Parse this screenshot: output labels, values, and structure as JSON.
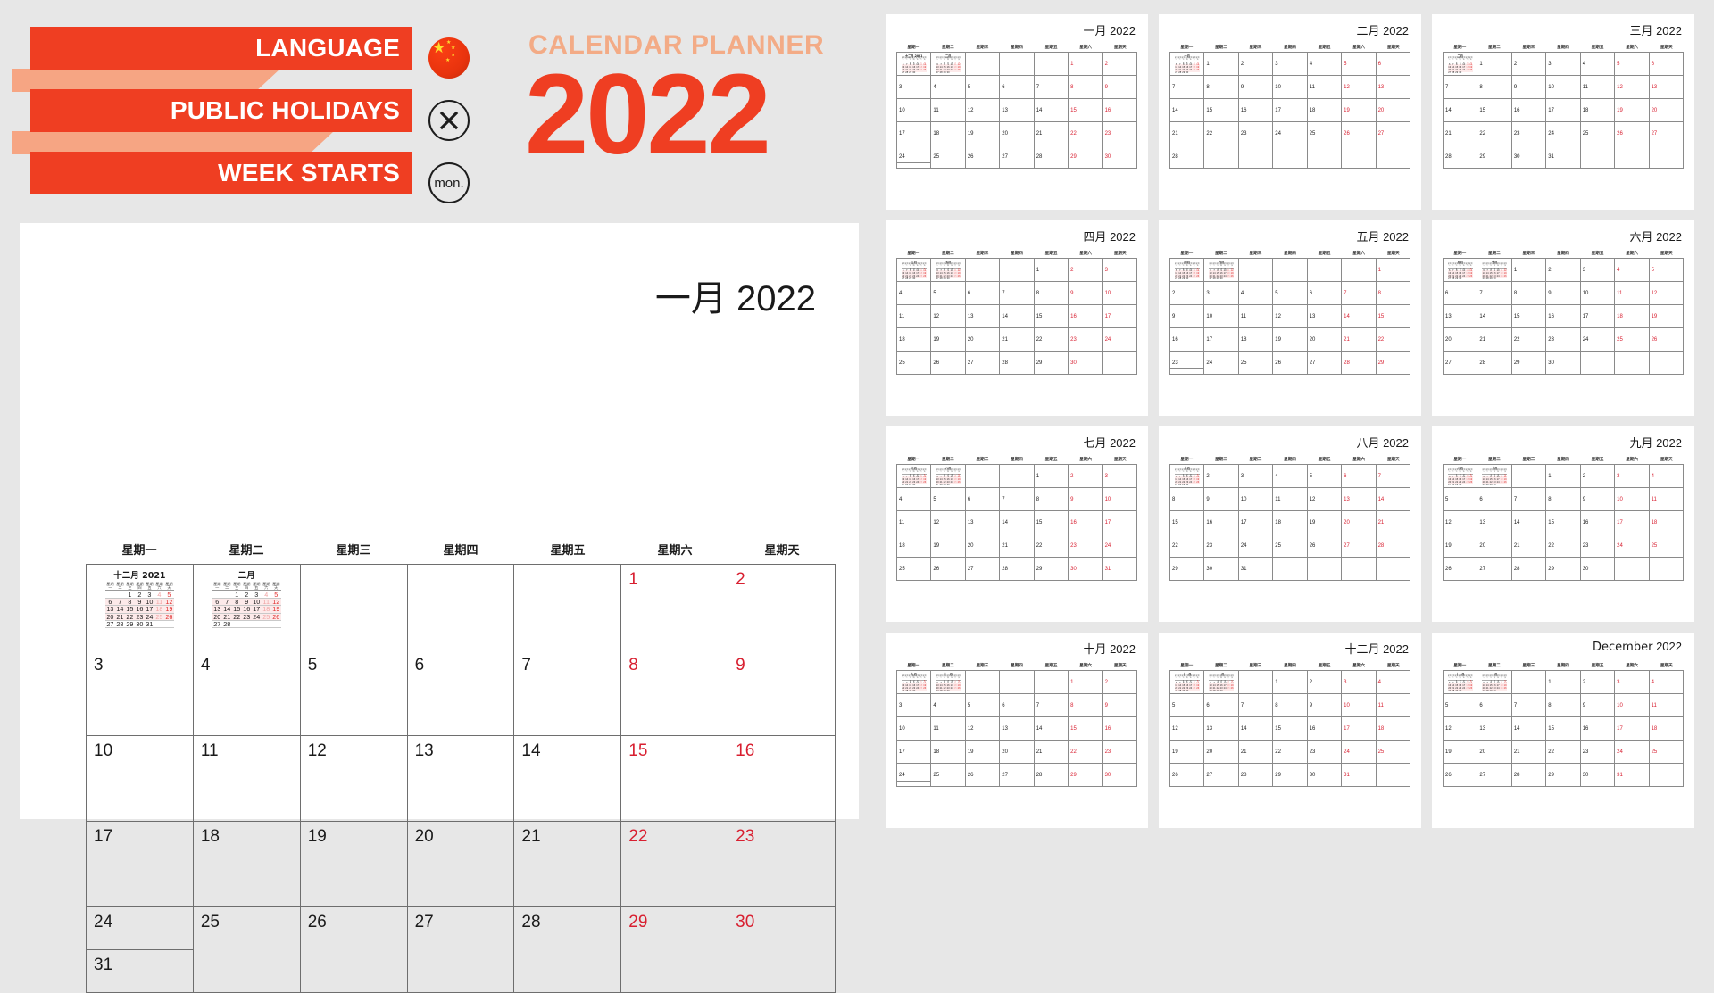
{
  "header": {
    "banners": [
      {
        "label": "LANGUAGE",
        "icon": "china-flag-icon"
      },
      {
        "label": "PUBLIC HOLIDAYS",
        "icon": "cross-circle-icon"
      },
      {
        "label": "WEEK STARTS",
        "icon": "monday-badge-icon"
      }
    ],
    "week_starts_badge": "mon.",
    "kicker": "CALENDAR PLANNER",
    "year": "2022",
    "accent_red": "#ef3e22",
    "accent_peach": "#f3ab86",
    "weekend_red": "#d81f30"
  },
  "main": {
    "title_month": "一月",
    "title_year": "2022",
    "weekdays": [
      "星期一",
      "星期二",
      "星期三",
      "星期四",
      "星期五",
      "星期六",
      "星期天"
    ],
    "weeks": [
      [
        {
          "mini": true
        },
        {
          "mini2": true
        },
        {
          "d": ""
        },
        {
          "d": ""
        },
        {
          "d": ""
        },
        {
          "d": "1",
          "w": true
        },
        {
          "d": "2",
          "w": true
        }
      ],
      [
        {
          "d": "3"
        },
        {
          "d": "4"
        },
        {
          "d": "5"
        },
        {
          "d": "6"
        },
        {
          "d": "7"
        },
        {
          "d": "8",
          "w": true
        },
        {
          "d": "9",
          "w": true
        }
      ],
      [
        {
          "d": "10"
        },
        {
          "d": "11"
        },
        {
          "d": "12"
        },
        {
          "d": "13"
        },
        {
          "d": "14"
        },
        {
          "d": "15",
          "w": true
        },
        {
          "d": "16",
          "w": true
        }
      ],
      [
        {
          "d": "17"
        },
        {
          "d": "18"
        },
        {
          "d": "19"
        },
        {
          "d": "20"
        },
        {
          "d": "21"
        },
        {
          "d": "22",
          "w": true
        },
        {
          "d": "23",
          "w": true
        }
      ],
      [
        {
          "d": "24",
          "d2": "31",
          "split": true
        },
        {
          "d": "25"
        },
        {
          "d": "26"
        },
        {
          "d": "27"
        },
        {
          "d": "28"
        },
        {
          "d": "29",
          "w": true
        },
        {
          "d": "30",
          "w": true
        }
      ]
    ],
    "mini_prev": {
      "title": "十二月 2021",
      "weekdays": [
        "星期一",
        "星期二",
        "星期三",
        "星期四",
        "星期五",
        "星期六",
        "星期天"
      ],
      "rows": [
        [
          "",
          "",
          "1",
          "2",
          "3",
          "4",
          "5"
        ],
        [
          "6",
          "7",
          "8",
          "9",
          "10",
          "11",
          "12"
        ],
        [
          "13",
          "14",
          "15",
          "16",
          "17",
          "18",
          "19"
        ],
        [
          "20",
          "21",
          "22",
          "23",
          "24",
          "25",
          "26"
        ],
        [
          "27",
          "28",
          "29",
          "30",
          "31",
          "",
          ""
        ]
      ],
      "highlight_rows": [
        1,
        2,
        3
      ]
    },
    "mini_next": {
      "title": "二月",
      "weekdays": [
        "星期一",
        "星期二",
        "星期三",
        "星期四",
        "星期五",
        "星期六",
        "星期天"
      ],
      "rows": [
        [
          "",
          "",
          "1",
          "2",
          "3",
          "4",
          "5"
        ],
        [
          "6",
          "7",
          "8",
          "9",
          "10",
          "11",
          "12"
        ],
        [
          "13",
          "14",
          "15",
          "16",
          "17",
          "18",
          "19"
        ],
        [
          "20",
          "21",
          "22",
          "23",
          "24",
          "25",
          "26"
        ],
        [
          "27",
          "28",
          "",
          "",
          "",
          "",
          ""
        ]
      ],
      "highlight_rows": [
        1,
        2,
        3
      ]
    }
  },
  "thumbnails": [
    {
      "title_month": "一月",
      "title_year": "2022",
      "first_weekday": 5,
      "days": 31,
      "mini_prev": "十二月 2021",
      "mini_next": "二月"
    },
    {
      "title_month": "二月",
      "title_year": "2022",
      "first_weekday": 1,
      "days": 28,
      "mini_prev": "一月",
      "mini_next": "三月"
    },
    {
      "title_month": "三月",
      "title_year": "2022",
      "first_weekday": 1,
      "days": 31,
      "mini_prev": "二月",
      "mini_next": "四月"
    },
    {
      "title_month": "四月",
      "title_year": "2022",
      "first_weekday": 4,
      "days": 30,
      "mini_prev": "三月",
      "mini_next": "五月"
    },
    {
      "title_month": "五月",
      "title_year": "2022",
      "first_weekday": 6,
      "days": 31,
      "mini_prev": "四月",
      "mini_next": "六月"
    },
    {
      "title_month": "六月",
      "title_year": "2022",
      "first_weekday": 2,
      "days": 30,
      "mini_prev": "五月",
      "mini_next": "七月"
    },
    {
      "title_month": "七月",
      "title_year": "2022",
      "first_weekday": 4,
      "days": 31,
      "mini_prev": "六月",
      "mini_next": "八月"
    },
    {
      "title_month": "八月",
      "title_year": "2022",
      "first_weekday": 0,
      "days": 31,
      "mini_prev": "七月",
      "mini_next": "九月"
    },
    {
      "title_month": "九月",
      "title_year": "2022",
      "first_weekday": 3,
      "days": 30,
      "mini_prev": "八月",
      "mini_next": "十月"
    },
    {
      "title_month": "十月",
      "title_year": "2022",
      "first_weekday": 5,
      "days": 31,
      "mini_prev": "九月",
      "mini_next": "十一月"
    },
    {
      "title_month": "十二月",
      "title_year": "2022",
      "first_weekday": 3,
      "days": 31,
      "mini_prev": "十一月",
      "mini_next": "一月"
    },
    {
      "title_month": "December",
      "title_year": "2022",
      "first_weekday": 3,
      "days": 31,
      "mini_prev": "十一月",
      "mini_next": "一月"
    }
  ],
  "thumb_weekdays": [
    "星期一",
    "星期二",
    "星期三",
    "星期四",
    "星期五",
    "星期六",
    "星期天"
  ]
}
